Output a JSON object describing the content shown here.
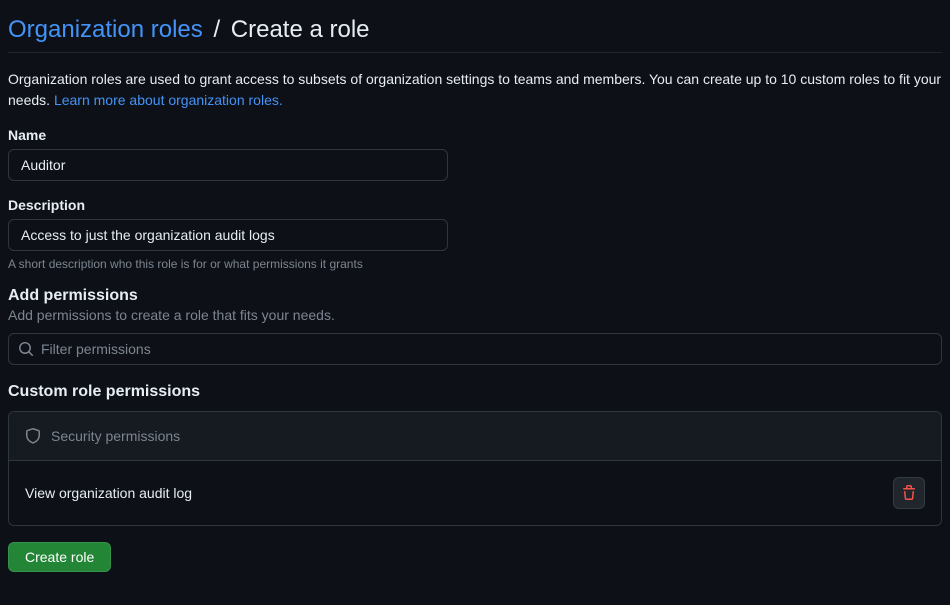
{
  "breadcrumb": {
    "parent": "Organization roles",
    "separator": "/",
    "current": "Create a role"
  },
  "intro": {
    "text": "Organization roles are used to grant access to subsets of organization settings to teams and members. You can create up to 10 custom roles to fit your needs. ",
    "link": "Learn more about organization roles."
  },
  "fields": {
    "name": {
      "label": "Name",
      "value": "Auditor"
    },
    "description": {
      "label": "Description",
      "value": "Access to just the organization audit logs",
      "helper": "A short description who this role is for or what permissions it grants"
    }
  },
  "add_permissions": {
    "title": "Add permissions",
    "subtitle": "Add permissions to create a role that fits your needs.",
    "filter_placeholder": "Filter permissions"
  },
  "custom_permissions": {
    "title": "Custom role permissions",
    "group": "Security permissions",
    "items": [
      "View organization audit log"
    ]
  },
  "actions": {
    "create": "Create role"
  }
}
